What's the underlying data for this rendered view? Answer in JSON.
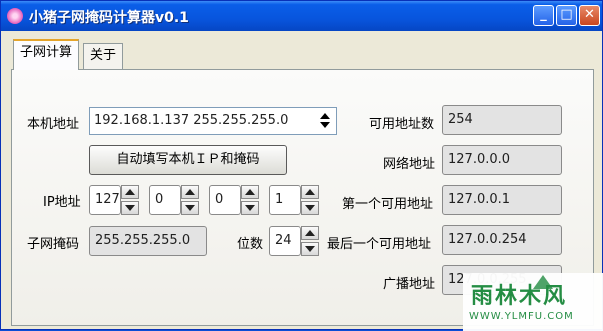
{
  "window": {
    "title": "小猪子网掩码计算器v0.1",
    "controls": {
      "minimize": "_",
      "maximize": "□",
      "close": "✕"
    }
  },
  "tabs": [
    {
      "label": "子网计算",
      "active": true
    },
    {
      "label": "关于",
      "active": false
    }
  ],
  "form": {
    "host_label": "本机地址",
    "host_value": "192.168.1.137 255.255.255.0",
    "autofill_button": "自动填写本机ＩＰ和掩码",
    "ip_label": "IP地址",
    "ip_octets": [
      "127",
      "0",
      "0",
      "1"
    ],
    "mask_label": "子网掩码",
    "mask_value": "255.255.255.0",
    "bits_label": "位数",
    "bits_value": "24"
  },
  "results": {
    "usable_count_label": "可用地址数",
    "usable_count_value": "254",
    "network_label": "网络地址",
    "network_value": "127.0.0.0",
    "first_label": "第一个可用地址",
    "first_value": "127.0.0.1",
    "last_label": "最后一个可用地址",
    "last_value": "127.0.0.254",
    "broadcast_label": "广播地址",
    "broadcast_value": "127.0.0.255"
  },
  "watermark": {
    "text": "雨林木风",
    "url": "WWW.YLMFU.COM"
  },
  "colors": {
    "titlebar": "#0855dd",
    "window_bg": "#ece9d8",
    "field_bg": "#e3e3e3",
    "watermark": "#1d8a3e"
  }
}
